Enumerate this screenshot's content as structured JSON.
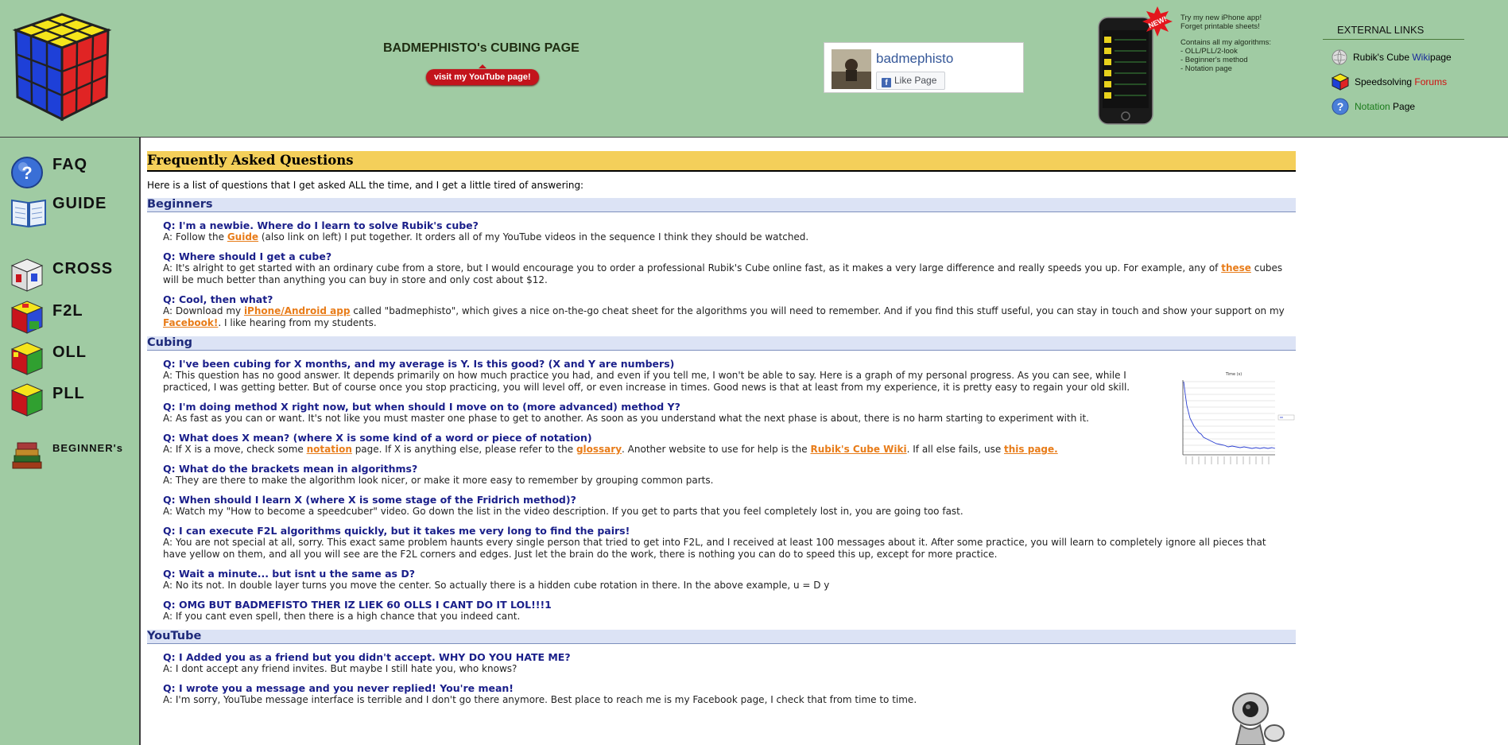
{
  "header": {
    "site_title": "BADMEPHISTO's CUBING PAGE",
    "youtube_button": "visit my YouTube page!",
    "facebook": {
      "name": "badmephisto",
      "like_label": "Like Page"
    },
    "iphone_badge": "NEW!",
    "app_promo": {
      "line1": "Try my new iPhone app!",
      "line2": "Forget printable sheets!",
      "line3": "Contains all my algorithms:",
      "line4": "- OLL/PLL/2-look",
      "line5": "- Beginner's method",
      "line6": "- Notation page"
    },
    "external_links": {
      "title": "EXTERNAL LINKS",
      "items": [
        {
          "pre": "Rubik's Cube ",
          "hl": "Wiki",
          "post": " page",
          "hl_color": "#1a2a9a"
        },
        {
          "pre": "Speedsolving ",
          "hl": "Forums",
          "post": "",
          "hl_color": "#d01010"
        },
        {
          "pre": "Notation ",
          "hl": "Page",
          "post": "",
          "hl_color": "#111111",
          "pre_color": "#1a7a1a"
        }
      ]
    }
  },
  "nav": {
    "faq": "FAQ",
    "guide": "GUIDE",
    "cross": "CROSS",
    "f2l": "F2L",
    "oll": "OLL",
    "pll": "PLL",
    "beginners": "BEGINNER's"
  },
  "main": {
    "title": "Frequently Asked Questions",
    "intro": "Here is a list of questions that I get asked ALL the time, and I get a little tired of answering:",
    "sections": {
      "beginners": "Beginners",
      "cubing": "Cubing",
      "youtube": "YouTube"
    },
    "qa": {
      "q1": "Q: I'm a newbie. Where do I learn to solve Rubik's cube?",
      "a1_pre": "A: Follow the ",
      "a1_link": "Guide",
      "a1_post": " (also link on left) I put together. It orders all of my YouTube videos in the sequence I think they should be watched.",
      "q2": "Q: Where should I get a cube?",
      "a2_pre": "A: It's alright to get started with an ordinary cube from a store, but I would encourage you to order a professional Rubik's Cube online fast, as it makes a very large difference and really speeds you up. For example, any of ",
      "a2_link": "these",
      "a2_post": " cubes will be much better than anything you can buy in store and only cost about $12.",
      "q3": "Q: Cool, then what?",
      "a3_pre": "A: Download my ",
      "a3_link1": "iPhone/Android app",
      "a3_mid": " called \"badmephisto\", which gives a nice on-the-go cheat sheet for the algorithms you will need to remember. And if you find this stuff useful, you can stay in touch and show your support on my ",
      "a3_link2": "Facebook!",
      "a3_post": ". I like hearing from my students.",
      "q4": "Q: I've been cubing for X months, and my average is Y. Is this good? (X and Y are numbers)",
      "a4": "A: This question has no good answer. It depends primarily on how much practice you had, and even if you tell me, I won't be able to say. Here is a graph of my personal progress. As you can see, while I practiced, I was getting better. But of course once you stop practicing, you will level off, or even increase in times. Good news is that at least from my experience, it is pretty easy to regain your old skill.",
      "q5": "Q: I'm doing method X right now, but when should I move on to (more advanced) method Y?",
      "a5": "A: As fast as you can or want. It's not like you must master one phase to get to another. As soon as you understand what the next phase is about, there is no harm starting to experiment with it.",
      "q6": "Q: What does X mean? (where X is some kind of a word or piece of notation)",
      "a6_pre": "A: If X is a move, check some ",
      "a6_link1": "notation",
      "a6_mid1": " page. If X is anything else, please refer to the ",
      "a6_link2": "glossary",
      "a6_mid2": ". Another website to use for help is the ",
      "a6_link3": "Rubik's Cube Wiki",
      "a6_mid3": ". If all else fails, use ",
      "a6_link4": "this page.",
      "q7": "Q: What do the brackets mean in algorithms?",
      "a7": "A: They are there to make the algorithm look nicer, or make it more easy to remember by grouping common parts.",
      "q8": "Q: When should I learn X (where X is some stage of the Fridrich method)?",
      "a8": "A: Watch my \"How to become a speedcuber\" video. Go down the list in the video description. If you get to parts that you feel completely lost in, you are going too fast.",
      "q9": "Q: I can execute F2L algorithms quickly, but it takes me very long to find the pairs!",
      "a9": "A: You are not special at all, sorry. This exact same problem haunts every single person that tried to get into F2L, and I received at least 100 messages about it. After some practice, you will learn to completely ignore all pieces that have yellow on them, and all you will see are the F2L corners and edges. Just let the brain do the work, there is nothing you can do to speed this up, except for more practice.",
      "q10": "Q: Wait a minute... but isnt u the same as D?",
      "a10": "A: No its not. In double layer turns you move the center. So actually there is a hidden cube rotation in there. In the above example, u = D y",
      "q11": "Q: OMG BUT BADMEFISTO THER IZ LIEK 60 OLLS I CANT DO IT LOL!!!1",
      "a11": "A: If you cant even spell, then there is a high chance that you indeed cant.",
      "q12": "Q: I Added you as a friend but you didn't accept. WHY DO YOU HATE ME?",
      "a12": "A: I dont accept any friend invites. But maybe I still hate you, who knows?",
      "q13": "Q: I wrote you a message and you never replied! You're mean!",
      "a13": "A: I'm sorry, YouTube message interface is terrible and I don't go there anymore. Best place to reach me is my Facebook page, I check that from time to time."
    }
  },
  "graph": {
    "title": "Time (s)"
  }
}
